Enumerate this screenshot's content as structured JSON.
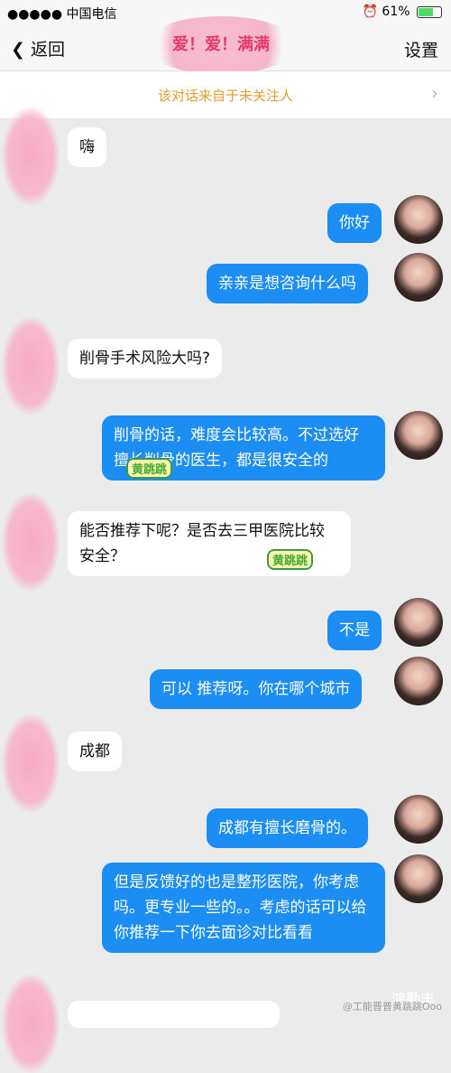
{
  "status": {
    "carrier": "●●●●● 中国电信",
    "battery": "61%",
    "battery_level": 0.61
  },
  "nav": {
    "back": "返回",
    "title_decoration": "爱！爱！满满",
    "settings": "设置"
  },
  "notice": {
    "text": "该对话来自于未关注人"
  },
  "messages": [
    {
      "from": "them",
      "text": "嗨"
    },
    {
      "from": "me",
      "text": "你好"
    },
    {
      "from": "me",
      "text": "亲亲是想咨询什么吗"
    },
    {
      "from": "them",
      "text": "削骨手术风险大吗?"
    },
    {
      "from": "me",
      "text": "削骨的话，难度会比较高。不过选好擅长削骨的医生，都是很安全的"
    },
    {
      "from": "them",
      "text": "能否推荐下呢？是否去三甲医院比较安全？"
    },
    {
      "from": "me",
      "text": "不是"
    },
    {
      "from": "me",
      "text": "可以 推荐呀。你在哪个城市"
    },
    {
      "from": "them",
      "text": "成都"
    },
    {
      "from": "me",
      "text": "成都有擅长磨骨的。"
    },
    {
      "from": "me",
      "text": "但是反馈好的也是整形医院，你考虑吗。更专业一些的。。考虑的话可以给你推荐一下你去面诊对比看看"
    }
  ],
  "stickers": [
    "黄跳跳",
    "黄跳跳"
  ],
  "watermark": {
    "site": "鸿勤丰",
    "weibo": "@工能晋普黄跳跳Ooo"
  }
}
